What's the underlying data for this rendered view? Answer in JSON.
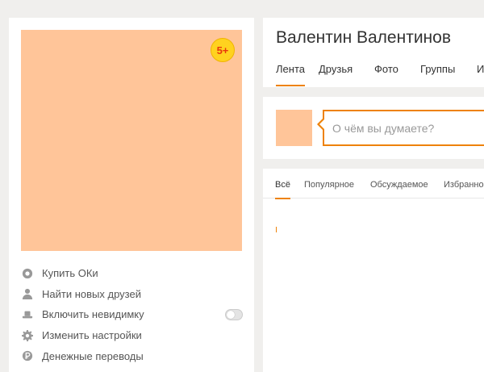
{
  "profile": {
    "name": "Валентин Валентинов",
    "badge": "5+"
  },
  "profile_tabs": [
    {
      "label": "Лента",
      "active": true
    },
    {
      "label": "Друзья",
      "active": false
    },
    {
      "label": "Фото",
      "active": false
    },
    {
      "label": "Группы",
      "active": false
    },
    {
      "label": "И",
      "active": false
    }
  ],
  "left_menu": [
    {
      "label": "Купить ОКи",
      "icon": "coin-icon"
    },
    {
      "label": "Найти новых друзей",
      "icon": "person-icon"
    },
    {
      "label": "Включить невидимку",
      "icon": "hat-icon",
      "toggle": false
    },
    {
      "label": "Изменить настройки",
      "icon": "gear-icon"
    },
    {
      "label": "Денежные переводы",
      "icon": "money-transfer-icon"
    }
  ],
  "post": {
    "placeholder": "О чём вы думаете?"
  },
  "feed_tabs": [
    {
      "label": "Всё",
      "active": true
    },
    {
      "label": "Популярное",
      "active": false
    },
    {
      "label": "Обсуждаемое",
      "active": false
    },
    {
      "label": "Избранное",
      "active": false
    }
  ],
  "colors": {
    "accent": "#ee8208",
    "avatar_placeholder": "#ffc599",
    "badge": "#ffd21f",
    "background": "#f0efed"
  }
}
